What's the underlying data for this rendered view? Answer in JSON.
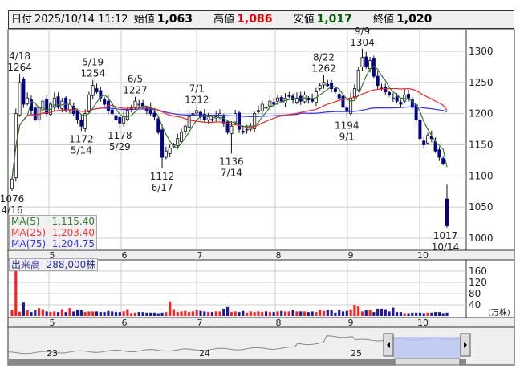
{
  "header": {
    "date_label": "日付",
    "datetime": "2025/10/14 11:12",
    "open_label": "始値",
    "open": "1,063",
    "high_label": "高値",
    "high": "1,086",
    "low_label": "安値",
    "low": "1,017",
    "close_label": "終値",
    "close": "1,020"
  },
  "colors": {
    "up": "#ffffff",
    "down": "#00008b",
    "ma5": "#2e7d2e",
    "ma25": "#ff2020",
    "ma75": "#3030ff",
    "vol_up": "#ff2020",
    "vol_down": "#1a1aa0",
    "high_text": "#e00000",
    "low_text": "#006000"
  },
  "legend": {
    "ma5_label": "MA(5)",
    "ma5": "1,115.40",
    "ma25_label": "MA(25)",
    "ma25": "1,203.40",
    "ma75_label": "MA(75)",
    "ma75": "1,204.75"
  },
  "volume": {
    "label": "出来高",
    "value": "288,000株",
    "unit": "(万株)",
    "ticks": [
      "160",
      "120",
      "80",
      "40"
    ]
  },
  "price_ticks": [
    "1300",
    "1250",
    "1200",
    "1150",
    "1100",
    "1050",
    "1000"
  ],
  "month_labels": [
    "5",
    "6",
    "7",
    "8",
    "9",
    "10"
  ],
  "navigator_labels": [
    "23",
    "24",
    "25"
  ],
  "chart_data": {
    "type": "candlestick",
    "closes": [
      1095,
      1200,
      1250,
      1215,
      1225,
      1205,
      1190,
      1210,
      1220,
      1200,
      1215,
      1225,
      1210,
      1220,
      1205,
      1215,
      1200,
      1190,
      1180,
      1200,
      1230,
      1245,
      1235,
      1225,
      1215,
      1205,
      1200,
      1190,
      1185,
      1195,
      1205,
      1210,
      1220,
      1215,
      1210,
      1205,
      1200,
      1195,
      1170,
      1130,
      1140,
      1145,
      1150,
      1160,
      1170,
      1180,
      1195,
      1200,
      1205,
      1195,
      1190,
      1195,
      1190,
      1195,
      1200,
      1185,
      1170,
      1180,
      1200,
      1175,
      1170,
      1175,
      1180,
      1200,
      1205,
      1215,
      1210,
      1220,
      1215,
      1225,
      1220,
      1225,
      1228,
      1222,
      1225,
      1220,
      1230,
      1222,
      1220,
      1235,
      1245,
      1250,
      1245,
      1240,
      1235,
      1225,
      1210,
      1205,
      1225,
      1240,
      1270,
      1290,
      1275,
      1285,
      1260,
      1245,
      1240,
      1235,
      1230,
      1225,
      1220,
      1215,
      1230,
      1225,
      1210,
      1190,
      1160,
      1150,
      1165,
      1160,
      1140,
      1130,
      1120,
      1020
    ],
    "last": {
      "open": 1063,
      "high": 1086,
      "low": 1017,
      "close": 1020
    },
    "volumes": [
      22,
      170,
      15,
      48,
      20,
      14,
      20,
      28,
      24,
      16,
      14,
      16,
      14,
      24,
      14,
      28,
      16,
      22,
      22,
      14,
      16,
      16,
      16,
      14,
      14,
      18,
      16,
      14,
      14,
      16,
      24,
      10,
      12,
      14,
      14,
      12,
      12,
      12,
      10,
      12,
      14,
      52,
      24,
      14,
      16,
      18,
      14,
      16,
      20,
      18,
      16,
      14,
      14,
      16,
      16,
      26,
      32,
      14,
      16,
      14,
      18,
      12,
      16,
      14,
      16,
      14,
      16,
      14,
      14,
      16,
      18,
      16,
      16,
      20,
      16,
      16,
      16,
      14,
      16,
      14,
      22,
      18,
      22,
      20,
      12,
      20,
      16,
      18,
      24,
      40,
      34,
      16,
      20,
      22,
      14,
      26,
      26,
      24,
      16,
      30,
      14,
      14,
      10,
      10,
      12,
      12,
      12,
      10,
      12,
      12,
      14,
      14,
      10,
      12,
      14,
      16,
      34
    ],
    "annotations": [
      {
        "i": 0,
        "price": 1076,
        "date": "4/16",
        "pos": "below"
      },
      {
        "i": 2,
        "price": 1264,
        "date": "4/18",
        "pos": "above"
      },
      {
        "i": 18,
        "price": 1172,
        "date": "5/14",
        "pos": "below"
      },
      {
        "i": 21,
        "price": 1254,
        "date": "5/19",
        "pos": "above"
      },
      {
        "i": 28,
        "price": 1178,
        "date": "5/29",
        "pos": "below"
      },
      {
        "i": 32,
        "price": 1227,
        "date": "6/5",
        "pos": "above"
      },
      {
        "i": 39,
        "price": 1112,
        "date": "6/17",
        "pos": "below"
      },
      {
        "i": 48,
        "price": 1212,
        "date": "7/1",
        "pos": "above"
      },
      {
        "i": 57,
        "price": 1136,
        "date": "7/14",
        "pos": "below"
      },
      {
        "i": 81,
        "price": 1262,
        "date": "8/22",
        "pos": "above"
      },
      {
        "i": 87,
        "price": 1194,
        "date": "9/1",
        "pos": "below"
      },
      {
        "i": 91,
        "price": 1304,
        "date": "9/9",
        "pos": "above"
      },
      {
        "i": 113,
        "price": 1017,
        "date": "10/14",
        "pos": "below"
      }
    ],
    "ylim": [
      985,
      1325
    ],
    "volume_ylim": [
      0,
      180
    ],
    "month_start_index": [
      10,
      31,
      52,
      74,
      95,
      116
    ]
  }
}
